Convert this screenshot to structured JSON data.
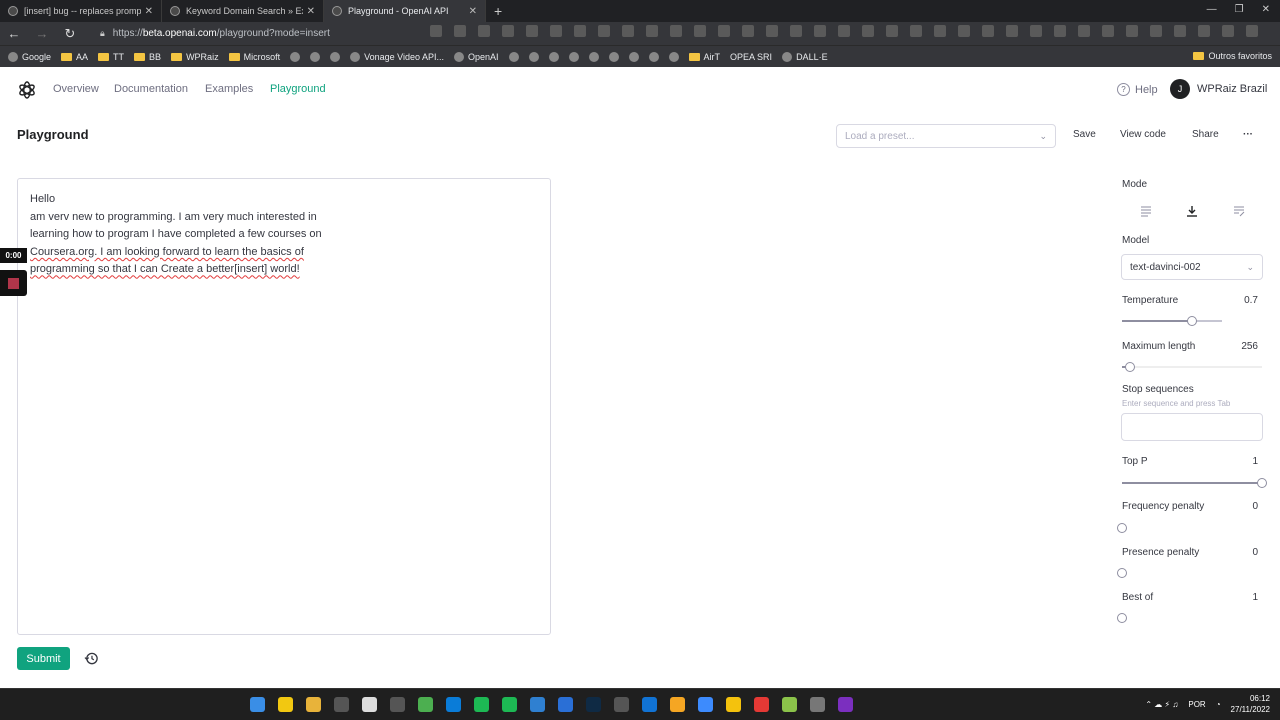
{
  "browser": {
    "tabs": [
      {
        "title": "[insert] bug -- replaces prompt t",
        "active": false
      },
      {
        "title": "Keyword Domain Search » Expire",
        "active": false
      },
      {
        "title": "Playground - OpenAI API",
        "active": true
      }
    ],
    "url_prefix": "https://",
    "url_host": "beta.openai.com",
    "url_path": "/playground?mode=insert",
    "bookmarks": [
      "Google",
      "AA",
      "TT",
      "BB",
      "WPRaiz",
      "Microsoft",
      "Vonage Video API...",
      "OpenAI",
      "AirT",
      "OPEA SRI",
      "DALL·E"
    ],
    "other_bookmarks": "Outros favoritos"
  },
  "app": {
    "nav": [
      "Overview",
      "Documentation",
      "Examples",
      "Playground"
    ],
    "help": "Help",
    "account_initial": "J",
    "account_name": "WPRaiz Brazil",
    "page_title": "Playground",
    "preset_placeholder": "Load a preset...",
    "toolbar": {
      "save": "Save",
      "view_code": "View code",
      "share": "Share",
      "more": "···"
    },
    "editor": {
      "line1": "Hello",
      "line2": "am verv new to programming. I am very much interested in",
      "line3": "learning how to program I have completed a few courses on",
      "line4": "Coursera.org. I am looking forward to learn the basics of",
      "line5": "programming so that I can Create a better[insert] world!"
    },
    "recorder_time": "0:00",
    "submit": "Submit"
  },
  "settings": {
    "mode_label": "Mode",
    "model_label": "Model",
    "model_value": "text-davinci-002",
    "temperature_label": "Temperature",
    "temperature_value": "0.7",
    "max_length_label": "Maximum length",
    "max_length_value": "256",
    "stop_label": "Stop sequences",
    "stop_hint": "Enter sequence and press Tab",
    "top_p_label": "Top P",
    "top_p_value": "1",
    "freq_label": "Frequency penalty",
    "freq_value": "0",
    "presence_label": "Presence penalty",
    "presence_value": "0",
    "best_of_label": "Best of",
    "best_of_value": "1"
  },
  "slider_levels": {
    "temperature": 0.7,
    "max_length": 0.06,
    "top_p": 1.0,
    "frequency": 0.0,
    "presence": 0.0,
    "best_of": 0.0
  },
  "taskbar": {
    "lang": "POR",
    "time": "06:12",
    "date": "27/11/2022"
  },
  "colors": {
    "accent": "#10a37f",
    "text": "#353740",
    "muted": "#6e6e80"
  }
}
